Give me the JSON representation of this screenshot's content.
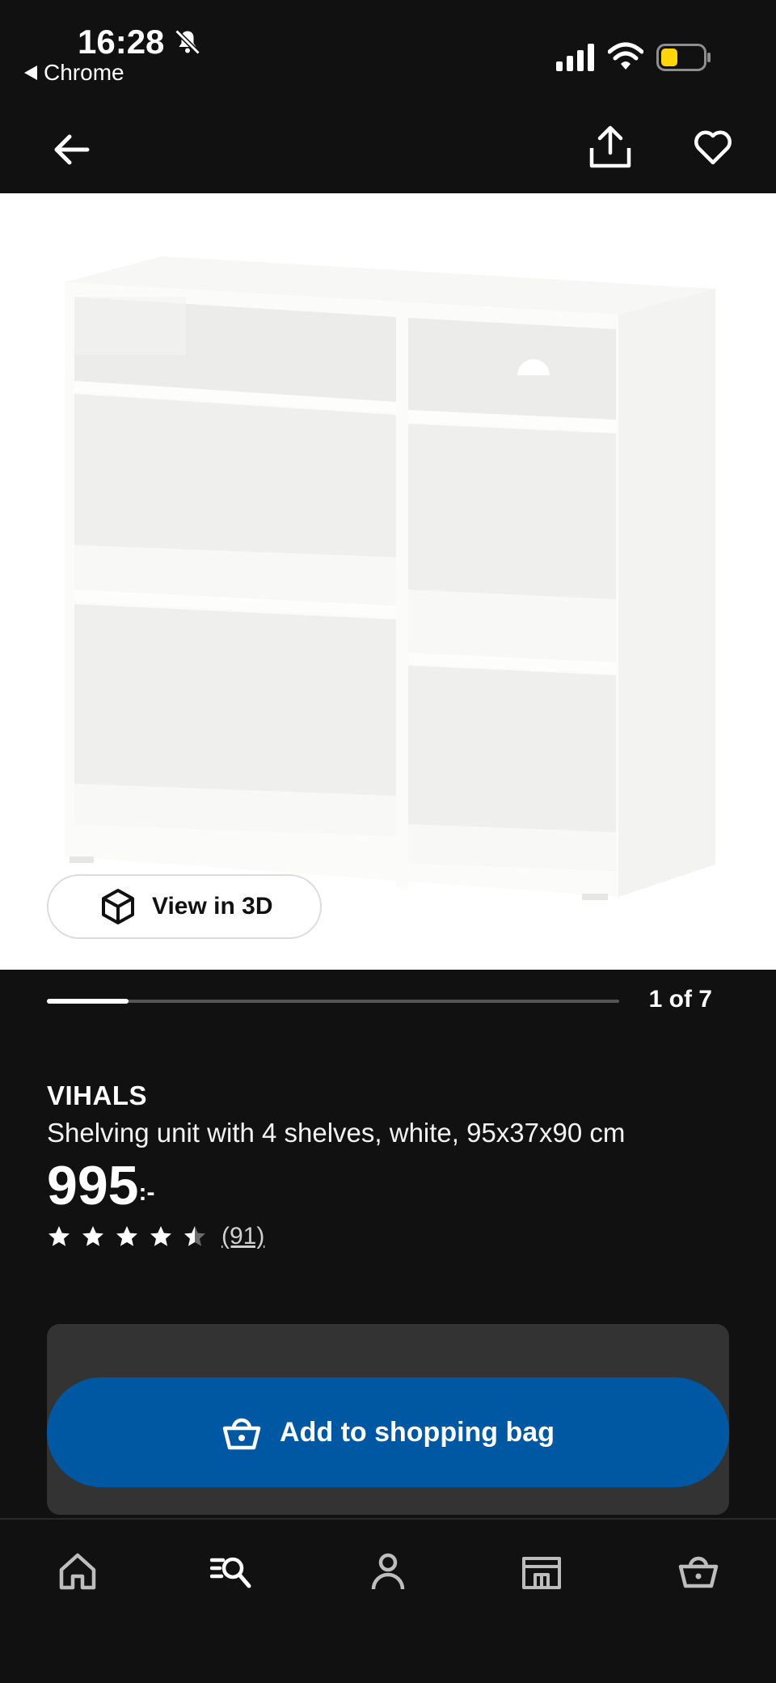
{
  "status_bar": {
    "time": "16:28",
    "back_app": "Chrome",
    "battery_color": "#FFD60A"
  },
  "top_nav": {
    "icons": [
      "arrow-left-icon",
      "share-icon",
      "heart-icon"
    ]
  },
  "hero": {
    "view_3d_label": "View in 3D",
    "image_counter": "1 of 7",
    "progress_fraction": 0.143
  },
  "product": {
    "brand": "VIHALS",
    "description": "Shelving unit with 4 shelves, white, 95x37x90 cm",
    "price": "995",
    "price_suffix": ":-",
    "rating": 4.5,
    "rating_max": 5,
    "review_count": "(91)"
  },
  "cta": {
    "add_to_bag_label": "Add to shopping bag",
    "color": "#0058A3"
  },
  "tab_bar": {
    "tabs": [
      "home-icon",
      "search-icon",
      "profile-icon",
      "store-icon",
      "basket-icon"
    ]
  }
}
